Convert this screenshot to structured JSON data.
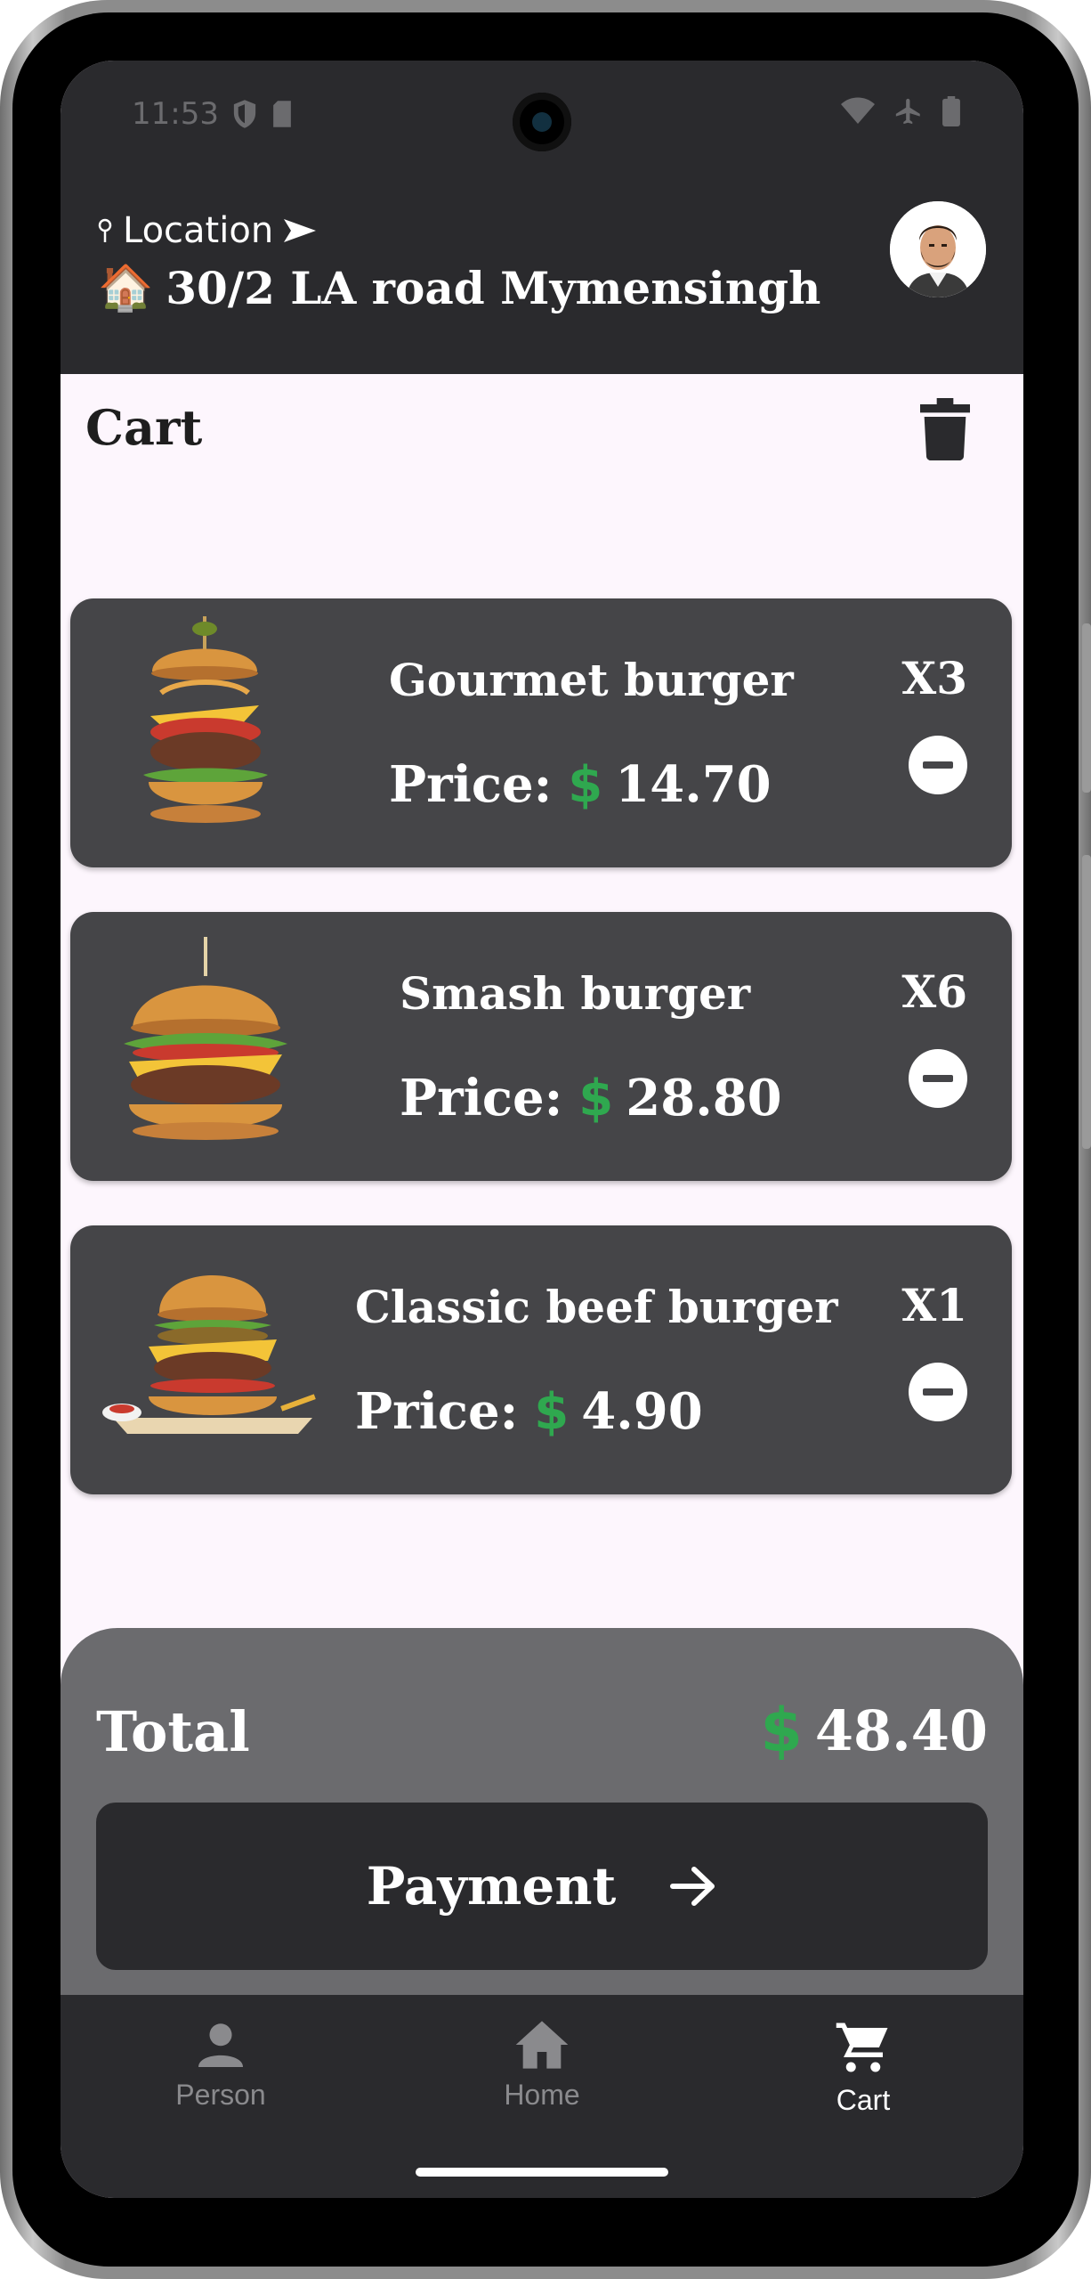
{
  "status_bar": {
    "time": "11:53"
  },
  "header": {
    "location_label": "Location",
    "address": "30/2 LA road Mymensingh",
    "house_emoji": "🏠"
  },
  "cart": {
    "title": "Cart",
    "items": [
      {
        "name": "Gourmet burger",
        "price_label": "Price:",
        "currency": "$",
        "price": "14.70",
        "quantity": "X3"
      },
      {
        "name": "Smash burger",
        "price_label": "Price:",
        "currency": "$",
        "price": "28.80",
        "quantity": "X6"
      },
      {
        "name": "Classic beef burger",
        "price_label": "Price:",
        "currency": "$",
        "price": "4.90",
        "quantity": "X1"
      }
    ]
  },
  "summary": {
    "total_label": "Total",
    "currency": "$",
    "total_value": "48.40",
    "payment_label": "Payment"
  },
  "bottom_nav": {
    "items": [
      {
        "label": "Person",
        "icon": "person-icon",
        "active": false
      },
      {
        "label": "Home",
        "icon": "home-icon",
        "active": false
      },
      {
        "label": "Cart",
        "icon": "cart-icon",
        "active": true
      }
    ]
  },
  "colors": {
    "header_bg": "#2a2a2d",
    "screen_bg": "#fdf6fd",
    "card_bg": "#454548",
    "total_panel_bg": "#6b6b6e",
    "currency_green": "#2fa84f",
    "nav_inactive": "#8a8a8d",
    "nav_active": "#ffffff"
  }
}
